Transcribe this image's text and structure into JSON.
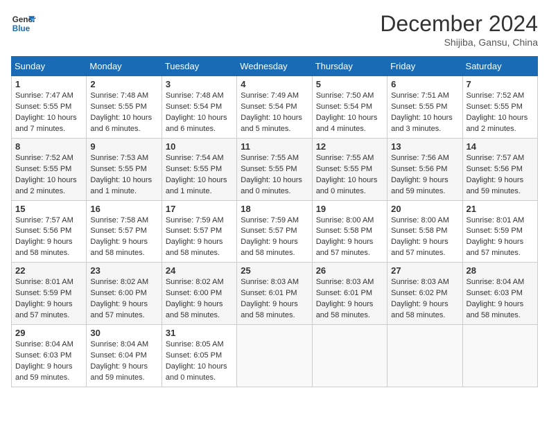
{
  "header": {
    "logo_line1": "General",
    "logo_line2": "Blue",
    "month": "December 2024",
    "location": "Shijiba, Gansu, China"
  },
  "weekdays": [
    "Sunday",
    "Monday",
    "Tuesday",
    "Wednesday",
    "Thursday",
    "Friday",
    "Saturday"
  ],
  "weeks": [
    [
      {
        "day": "1",
        "sunrise": "7:47 AM",
        "sunset": "5:55 PM",
        "daylight": "10 hours and 7 minutes."
      },
      {
        "day": "2",
        "sunrise": "7:48 AM",
        "sunset": "5:55 PM",
        "daylight": "10 hours and 6 minutes."
      },
      {
        "day": "3",
        "sunrise": "7:48 AM",
        "sunset": "5:54 PM",
        "daylight": "10 hours and 6 minutes."
      },
      {
        "day": "4",
        "sunrise": "7:49 AM",
        "sunset": "5:54 PM",
        "daylight": "10 hours and 5 minutes."
      },
      {
        "day": "5",
        "sunrise": "7:50 AM",
        "sunset": "5:54 PM",
        "daylight": "10 hours and 4 minutes."
      },
      {
        "day": "6",
        "sunrise": "7:51 AM",
        "sunset": "5:55 PM",
        "daylight": "10 hours and 3 minutes."
      },
      {
        "day": "7",
        "sunrise": "7:52 AM",
        "sunset": "5:55 PM",
        "daylight": "10 hours and 2 minutes."
      }
    ],
    [
      {
        "day": "8",
        "sunrise": "7:52 AM",
        "sunset": "5:55 PM",
        "daylight": "10 hours and 2 minutes."
      },
      {
        "day": "9",
        "sunrise": "7:53 AM",
        "sunset": "5:55 PM",
        "daylight": "10 hours and 1 minute."
      },
      {
        "day": "10",
        "sunrise": "7:54 AM",
        "sunset": "5:55 PM",
        "daylight": "10 hours and 1 minute."
      },
      {
        "day": "11",
        "sunrise": "7:55 AM",
        "sunset": "5:55 PM",
        "daylight": "10 hours and 0 minutes."
      },
      {
        "day": "12",
        "sunrise": "7:55 AM",
        "sunset": "5:55 PM",
        "daylight": "10 hours and 0 minutes."
      },
      {
        "day": "13",
        "sunrise": "7:56 AM",
        "sunset": "5:56 PM",
        "daylight": "9 hours and 59 minutes."
      },
      {
        "day": "14",
        "sunrise": "7:57 AM",
        "sunset": "5:56 PM",
        "daylight": "9 hours and 59 minutes."
      }
    ],
    [
      {
        "day": "15",
        "sunrise": "7:57 AM",
        "sunset": "5:56 PM",
        "daylight": "9 hours and 58 minutes."
      },
      {
        "day": "16",
        "sunrise": "7:58 AM",
        "sunset": "5:57 PM",
        "daylight": "9 hours and 58 minutes."
      },
      {
        "day": "17",
        "sunrise": "7:59 AM",
        "sunset": "5:57 PM",
        "daylight": "9 hours and 58 minutes."
      },
      {
        "day": "18",
        "sunrise": "7:59 AM",
        "sunset": "5:57 PM",
        "daylight": "9 hours and 58 minutes."
      },
      {
        "day": "19",
        "sunrise": "8:00 AM",
        "sunset": "5:58 PM",
        "daylight": "9 hours and 57 minutes."
      },
      {
        "day": "20",
        "sunrise": "8:00 AM",
        "sunset": "5:58 PM",
        "daylight": "9 hours and 57 minutes."
      },
      {
        "day": "21",
        "sunrise": "8:01 AM",
        "sunset": "5:59 PM",
        "daylight": "9 hours and 57 minutes."
      }
    ],
    [
      {
        "day": "22",
        "sunrise": "8:01 AM",
        "sunset": "5:59 PM",
        "daylight": "9 hours and 57 minutes."
      },
      {
        "day": "23",
        "sunrise": "8:02 AM",
        "sunset": "6:00 PM",
        "daylight": "9 hours and 57 minutes."
      },
      {
        "day": "24",
        "sunrise": "8:02 AM",
        "sunset": "6:00 PM",
        "daylight": "9 hours and 58 minutes."
      },
      {
        "day": "25",
        "sunrise": "8:03 AM",
        "sunset": "6:01 PM",
        "daylight": "9 hours and 58 minutes."
      },
      {
        "day": "26",
        "sunrise": "8:03 AM",
        "sunset": "6:01 PM",
        "daylight": "9 hours and 58 minutes."
      },
      {
        "day": "27",
        "sunrise": "8:03 AM",
        "sunset": "6:02 PM",
        "daylight": "9 hours and 58 minutes."
      },
      {
        "day": "28",
        "sunrise": "8:04 AM",
        "sunset": "6:03 PM",
        "daylight": "9 hours and 58 minutes."
      }
    ],
    [
      {
        "day": "29",
        "sunrise": "8:04 AM",
        "sunset": "6:03 PM",
        "daylight": "9 hours and 59 minutes."
      },
      {
        "day": "30",
        "sunrise": "8:04 AM",
        "sunset": "6:04 PM",
        "daylight": "9 hours and 59 minutes."
      },
      {
        "day": "31",
        "sunrise": "8:05 AM",
        "sunset": "6:05 PM",
        "daylight": "10 hours and 0 minutes."
      },
      null,
      null,
      null,
      null
    ]
  ]
}
